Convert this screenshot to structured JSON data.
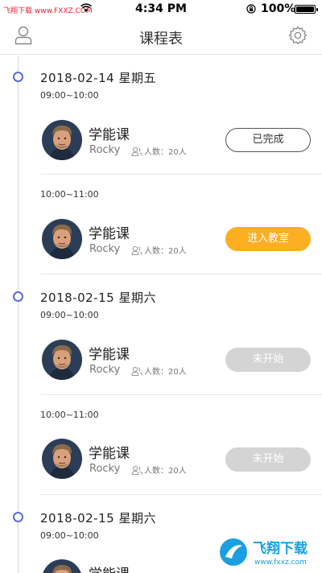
{
  "status_bar": {
    "watermark": "飞翔下载 www.FXXZ.COM",
    "time": "4:34 PM",
    "battery": "100%",
    "battery_level": 1.0
  },
  "header": {
    "title": "课程表"
  },
  "days": [
    {
      "date": "2018-02-14 星期五",
      "slots": [
        {
          "time": "09:00~10:00",
          "course": "学能课",
          "teacher": "Rocky",
          "count": "人数：20人",
          "button": "已完成",
          "state": "done"
        },
        {
          "time": "10:00~11:00",
          "course": "学能课",
          "teacher": "Rocky",
          "count": "人数：20人",
          "button": "进入教室",
          "state": "enter"
        }
      ]
    },
    {
      "date": "2018-02-15 星期六",
      "slots": [
        {
          "time": "09:00~10:00",
          "course": "学能课",
          "teacher": "Rocky",
          "count": "人数：20人",
          "button": "未开始",
          "state": "pending"
        },
        {
          "time": "10:00~11:00",
          "course": "学能课",
          "teacher": "Rocky",
          "count": "人数：20人",
          "button": "未开始",
          "state": "pending"
        }
      ]
    },
    {
      "date": "2018-02-15 星期六",
      "slots": [
        {
          "time": "09:00~10:00",
          "course": "学能课"
        }
      ]
    }
  ],
  "corner_logo": {
    "text": "飞翔下载",
    "url": "www.fxxz.com"
  },
  "colors": {
    "accent_dot": "#5b6bd6",
    "enter_button": "#fdae21",
    "pending_button": "#d4d4d4"
  }
}
